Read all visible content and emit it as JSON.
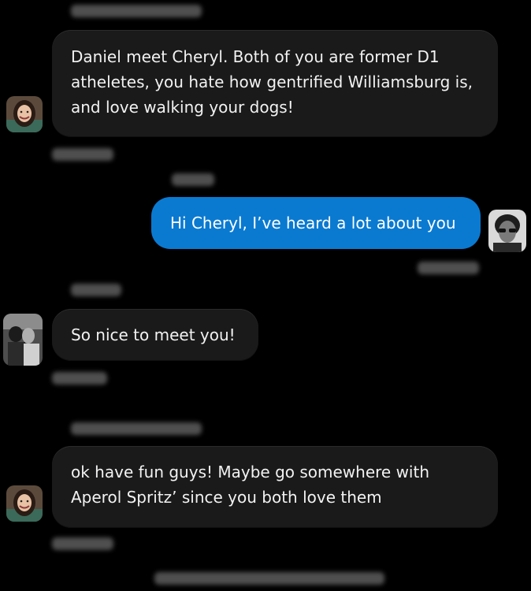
{
  "messages": [
    {
      "id": "m1",
      "side": "incoming",
      "avatar": "woman-smiling-avatar",
      "text": "Daniel meet Cheryl. Both of you are former D1\natheletes, you hate how gentrified Williamsburg is,\nand love walking your dogs!"
    },
    {
      "id": "m2",
      "side": "outgoing",
      "avatar": "man-sunglasses-avatar",
      "text": "Hi Cheryl, I’ve heard a lot about you"
    },
    {
      "id": "m3",
      "side": "incoming",
      "avatar": "couple-photo-avatar",
      "text": "So nice to meet you!"
    },
    {
      "id": "m4",
      "side": "incoming",
      "avatar": "woman-smiling-avatar",
      "text": "ok have fun guys! Maybe go somewhere with\nAperol Spritz’ since you both love them"
    }
  ],
  "colors": {
    "background": "#000000",
    "incoming_bubble": "#1a1a1b",
    "outgoing_bubble": "#0a7ad1",
    "text": "#ffffff"
  }
}
